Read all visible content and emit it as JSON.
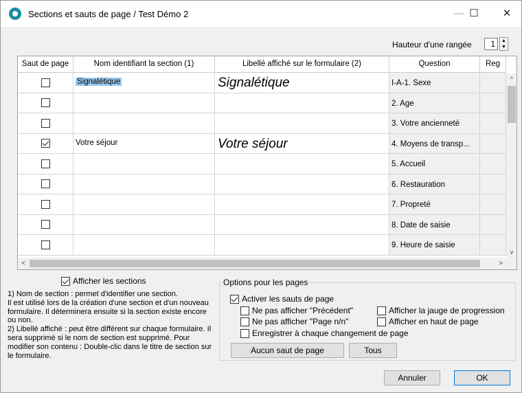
{
  "window": {
    "title": "Sections et sauts de page / Test Démo 2",
    "minimize": "—",
    "maximize": "☐",
    "close": "✕"
  },
  "row_height": {
    "label": "Hauteur d'une rangée",
    "value": "1",
    "spinner": "▲\n▼"
  },
  "table": {
    "columns": [
      "Saut de page",
      "Nom identifiant la section (1)",
      "Libellé affiché sur le formulaire (2)",
      "Question",
      "Reg"
    ],
    "rows": [
      {
        "page_break": false,
        "name": "Signalétique",
        "label": "Signalétique",
        "question": "I-A-1. Sexe"
      },
      {
        "page_break": false,
        "name": "",
        "label": "",
        "question": "2. Age"
      },
      {
        "page_break": false,
        "name": "",
        "label": "",
        "question": "3. Votre ancienneté"
      },
      {
        "page_break": true,
        "name": "Votre séjour",
        "label": "Votre séjour",
        "question": "4. Moyens de transp..."
      },
      {
        "page_break": false,
        "name": "",
        "label": "",
        "question": "5. Accueil"
      },
      {
        "page_break": false,
        "name": "",
        "label": "",
        "question": "6. Restauration"
      },
      {
        "page_break": false,
        "name": "",
        "label": "",
        "question": "7. Propreté"
      },
      {
        "page_break": false,
        "name": "",
        "label": "",
        "question": "8. Date de saisie"
      },
      {
        "page_break": false,
        "name": "",
        "label": "",
        "question": "9. Heure de saisie"
      }
    ],
    "scroll": {
      "up": "^",
      "down": "v",
      "left": "<",
      "right": ">"
    }
  },
  "show_sections": {
    "label": "Afficher les sections",
    "checked": true
  },
  "help": [
    "1) Nom de section : permet d'identifier une section.",
    "Il est utilisé lors de la création d'une section et d'un nouveau formulaire. Il déterminera ensuite si la section existe encore ou non.",
    "2) Libellé affiché : peut être différent sur chaque formulaire. Il sera supprimé si le nom de section est supprimé. Pour modifier son contenu : Double-clic dans le titre de section sur le formulaire."
  ],
  "page_options": {
    "title": "Options pour les pages",
    "enable_breaks": {
      "label": "Activer les sauts de page",
      "checked": true
    },
    "hide_previous": {
      "label": "Ne pas afficher \"Précédent\"",
      "checked": false
    },
    "hide_page_n": {
      "label": "Ne pas afficher \"Page n/n\"",
      "checked": false
    },
    "save_each_page": {
      "label": "Enregistrer à chaque changement de page",
      "checked": false
    },
    "show_progress": {
      "label": "Afficher la jauge de progression",
      "checked": false
    },
    "show_top": {
      "label": "Afficher en haut de page",
      "checked": false
    },
    "no_break_button": "Aucun saut de page",
    "all_button": "Tous"
  },
  "buttons": {
    "cancel": "Annuler",
    "ok": "OK"
  }
}
